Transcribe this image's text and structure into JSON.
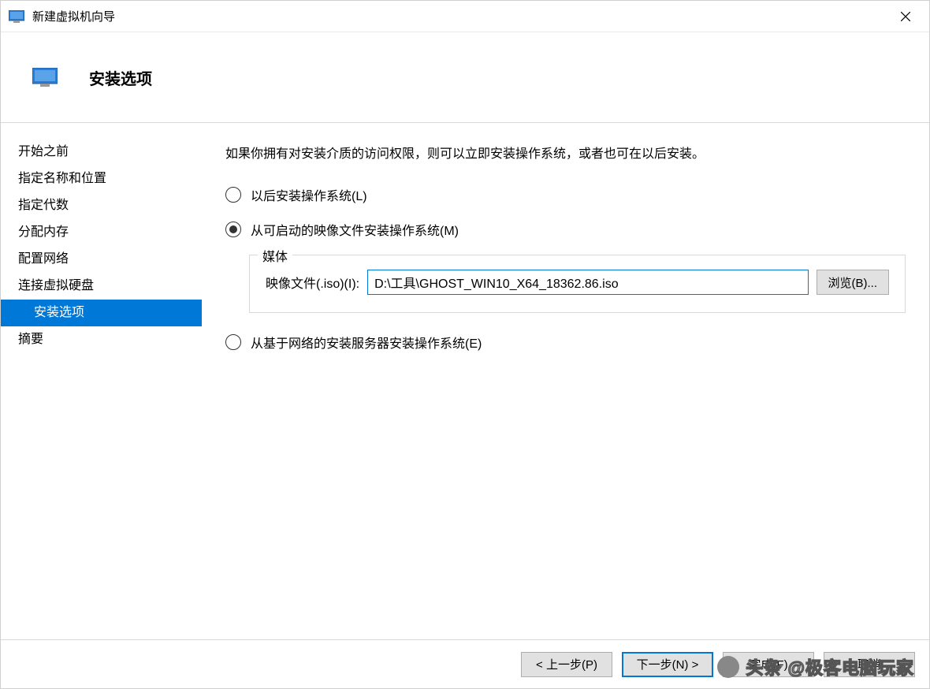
{
  "window": {
    "title": "新建虚拟机向导"
  },
  "header": {
    "title": "安装选项"
  },
  "sidebar": {
    "items": [
      {
        "label": "开始之前"
      },
      {
        "label": "指定名称和位置"
      },
      {
        "label": "指定代数"
      },
      {
        "label": "分配内存"
      },
      {
        "label": "配置网络"
      },
      {
        "label": "连接虚拟硬盘"
      },
      {
        "label": "安装选项"
      },
      {
        "label": "摘要"
      }
    ],
    "active_index": 6
  },
  "main": {
    "description": "如果你拥有对安装介质的访问权限，则可以立即安装操作系统，或者也可在以后安装。",
    "options": {
      "later": "以后安装操作系统(L)",
      "image": "从可启动的映像文件安装操作系统(M)",
      "network": "从基于网络的安装服务器安装操作系统(E)"
    },
    "selected_option": "image",
    "media": {
      "legend": "媒体",
      "field_label": "映像文件(.iso)(I):",
      "file_path": "D:\\工具\\GHOST_WIN10_X64_18362.86.iso",
      "browse": "浏览(B)..."
    }
  },
  "footer": {
    "prev": "< 上一步(P)",
    "next": "下一步(N) >",
    "finish": "完成(F)",
    "cancel": "取消"
  },
  "watermark": "头条 @极客电脑玩家"
}
